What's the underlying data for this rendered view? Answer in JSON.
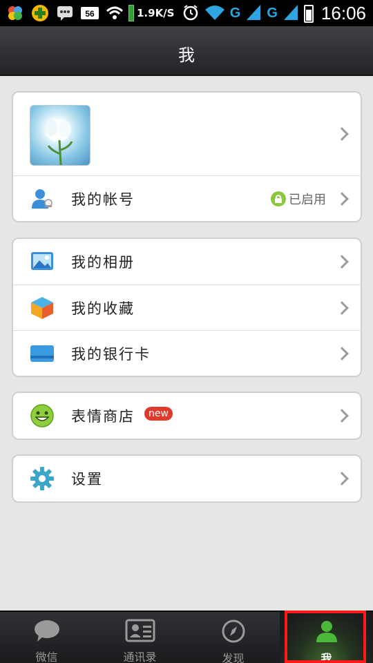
{
  "status_bar": {
    "speed": "1.9K/S",
    "net1": "G",
    "net2": "G",
    "time": "16:06"
  },
  "header": {
    "title": "我"
  },
  "account": {
    "account_label": "我的帐号",
    "account_status": "已启用"
  },
  "menu_group_1": [
    {
      "label": "我的相册",
      "icon": "photo-album-icon"
    },
    {
      "label": "我的收藏",
      "icon": "favorites-cube-icon"
    },
    {
      "label": "我的银行卡",
      "icon": "bank-card-icon"
    }
  ],
  "menu_group_2": {
    "label": "表情商店",
    "badge": "new",
    "icon": "smiley-icon"
  },
  "menu_group_3": {
    "label": "设置",
    "icon": "gear-icon"
  },
  "tabs": [
    {
      "label": "微信",
      "icon": "chat-bubble-icon"
    },
    {
      "label": "通讯录",
      "icon": "contacts-card-icon"
    },
    {
      "label": "发现",
      "icon": "compass-icon"
    },
    {
      "label": "我",
      "icon": "person-icon",
      "active": true
    }
  ],
  "colors": {
    "accent_green": "#2fa12f",
    "highlight_red": "#ff1a1a",
    "new_badge": "#e03a2c"
  }
}
